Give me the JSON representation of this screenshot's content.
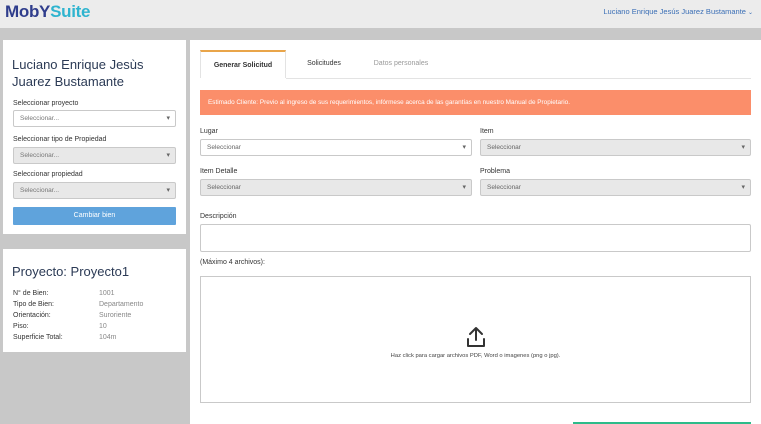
{
  "header": {
    "logo_part1": "MobY",
    "logo_part2": "Suite",
    "user_name": "Luciano Enrique Jesús Juarez Bustamante",
    "user_caret": "⌄"
  },
  "sidebar": {
    "user_card": {
      "name": "Luciano Enrique Jesùs Juarez Bustamante",
      "select_project_label": "Seleccionar proyecto",
      "select_project_value": "Seleccionar...",
      "select_type_label": "Seleccionar tipo de Propiedad",
      "select_type_value": "Seleccionar...",
      "select_property_label": "Seleccionar propiedad",
      "select_property_value": "Seleccionar...",
      "change_button": "Cambiar bien"
    },
    "project_card": {
      "title": "Proyecto: Proyecto1",
      "rows": [
        {
          "key": "N° de Bien:",
          "value": "1001"
        },
        {
          "key": "Tipo de Bien:",
          "value": "Departamento"
        },
        {
          "key": "Orientación:",
          "value": "Suroriente"
        },
        {
          "key": "Piso:",
          "value": "10"
        },
        {
          "key": "Superficie Total:",
          "value": "104m"
        }
      ]
    }
  },
  "tabs": [
    {
      "label": "Generar Solicitud",
      "active": true
    },
    {
      "label": "Solicitudes",
      "active": false
    },
    {
      "label": "Datos personales",
      "active": false
    }
  ],
  "alert": {
    "text": "Estimado Cliente: Previo al ingreso de sus requerimientos, infórmese acerca de las garantías en nuestro Manual de Propietario.",
    "color": "#fb8e6a"
  },
  "form": {
    "lugar_label": "Lugar",
    "lugar_value": "Seleccionar",
    "item_label": "Item",
    "item_value": "Seleccionar",
    "item_detalle_label": "Item Detalle",
    "item_detalle_value": "Seleccionar",
    "problema_label": "Problema",
    "problema_value": "Seleccionar",
    "descripcion_label": "Descripción",
    "max_files_label": "(Máximo 4 archivos):",
    "upload_text": "Haz click para cargar archivos PDF, Word o imagenes (png o jpg)."
  },
  "icons": {
    "dropdown": "chevron-down-icon",
    "upload": "upload-icon"
  },
  "colors": {
    "primary_button": "#5fa3dc",
    "active_tab_accent": "#e9a54a",
    "logo_dark": "#2f3d8c",
    "logo_light": "#2fb4cf"
  }
}
